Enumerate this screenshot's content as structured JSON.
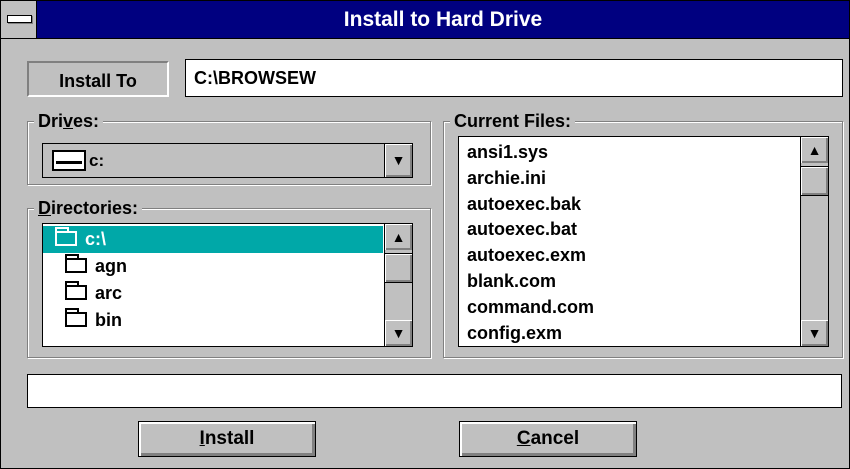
{
  "window": {
    "title": "Install to Hard Drive"
  },
  "install_to": {
    "label": "Install To",
    "path": "C:\\BROWSEW"
  },
  "drives": {
    "label": "Drives:",
    "label_pre": "Dri",
    "label_ul": "v",
    "label_post": "es:",
    "selected": "c:"
  },
  "directories": {
    "label_ul": "D",
    "label_post": "irectories:",
    "items": [
      {
        "name": "c:\\",
        "selected": true,
        "icon": "open-folder-icon"
      },
      {
        "name": "agn",
        "selected": false,
        "icon": "folder-icon"
      },
      {
        "name": "arc",
        "selected": false,
        "icon": "folder-icon"
      },
      {
        "name": "bin",
        "selected": false,
        "icon": "folder-icon"
      }
    ]
  },
  "current_files": {
    "label": "Current Files:",
    "items": [
      "ansi1.sys",
      "archie.ini",
      "autoexec.bak",
      "autoexec.bat",
      "autoexec.exm",
      "blank.com",
      "command.com",
      "config.exm"
    ]
  },
  "status": {
    "text": ""
  },
  "buttons": {
    "install": {
      "ul": "I",
      "rest": "nstall"
    },
    "cancel": {
      "ul": "C",
      "rest": "ancel"
    }
  },
  "icons": {
    "system_menu": "system-menu-icon",
    "drive": "hard-drive-icon",
    "scroll_up": "up-arrow-icon",
    "scroll_down": "down-arrow-icon",
    "dropdown": "down-arrow-icon"
  },
  "colors": {
    "title_bar": "#000080",
    "selection": "#00a8a8",
    "face": "#c0c0c0"
  }
}
